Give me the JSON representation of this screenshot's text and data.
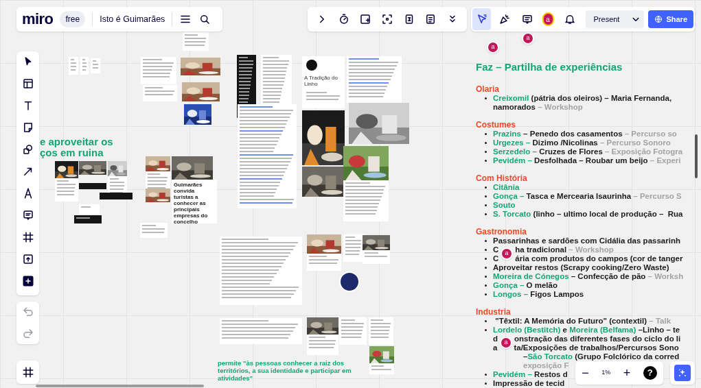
{
  "topbar": {
    "logo": "miro",
    "plan": "free",
    "board_title": "Isto é Guimarães"
  },
  "right_tools": [
    {
      "kind": "cursors",
      "selected": true
    },
    {
      "kind": "reactions",
      "selected": false
    },
    {
      "kind": "comments",
      "selected": false
    }
  ],
  "user": {
    "avatar": "a",
    "present": "Present",
    "share": "Share"
  },
  "canvas": {
    "avatars": [
      {
        "label": "a"
      },
      {
        "label": "a"
      },
      {
        "label": "a"
      },
      {
        "label": "a"
      }
    ],
    "left_heading_lines": [
      "e aproveitar os",
      "ços em ruina"
    ],
    "quote_lines": [
      "permite \"às pessoas conhecer a raiz dos",
      "territórios, a sua identidade e participar em",
      "atividades\""
    ],
    "cards": [
      {
        "title": "A Tradição do Linho"
      },
      {
        "title": "Guimarães convida turistas a conhecer as principais empresas do concelho"
      }
    ]
  },
  "panel": {
    "title": "Faz – Partilha de experiências",
    "sections": [
      {
        "title": "Olaria",
        "items": [
          {
            "lines": [
              {
                "segments": [
                  {
                    "kind": "place",
                    "text": "Creixomil"
                  },
                  {
                    "kind": "desc",
                    "text": " (pátria dos oleiros) – Maria Fernanda,"
                  }
                ]
              },
              {
                "segments": [
                  {
                    "kind": "desc",
                    "text": "namorados"
                  },
                  {
                    "kind": "activity",
                    "text": " – Workshop"
                  }
                ]
              }
            ]
          }
        ]
      },
      {
        "title": "Costumes",
        "items": [
          {
            "lines": [
              {
                "segments": [
                  {
                    "kind": "place",
                    "text": "Prazins"
                  },
                  {
                    "kind": "desc",
                    "text": " – Penedo dos casamentos"
                  },
                  {
                    "kind": "activity",
                    "text": " – Percurso so"
                  }
                ]
              }
            ]
          },
          {
            "lines": [
              {
                "segments": [
                  {
                    "kind": "place",
                    "text": "Urgezes – "
                  },
                  {
                    "kind": "desc",
                    "text": "Dizimo /Nicolinas"
                  },
                  {
                    "kind": "activity",
                    "text": " – Percurso Sonoro"
                  }
                ]
              }
            ]
          },
          {
            "lines": [
              {
                "segments": [
                  {
                    "kind": "place",
                    "text": "Serzedelo – "
                  },
                  {
                    "kind": "desc",
                    "text": "Cruzes de Flores"
                  },
                  {
                    "kind": "activity",
                    "text": " – Exposição Fotogra"
                  }
                ]
              }
            ]
          },
          {
            "lines": [
              {
                "segments": [
                  {
                    "kind": "place",
                    "text": "Pevidém – "
                  },
                  {
                    "kind": "desc",
                    "text": "Desfolhada – Roubar um beijo"
                  },
                  {
                    "kind": "activity",
                    "text": " – Experi"
                  }
                ]
              }
            ]
          }
        ]
      },
      {
        "title": "Com História",
        "items": [
          {
            "lines": [
              {
                "segments": [
                  {
                    "kind": "place",
                    "text": "Citânia"
                  }
                ]
              }
            ]
          },
          {
            "lines": [
              {
                "segments": [
                  {
                    "kind": "place",
                    "text": "Gonça – "
                  },
                  {
                    "kind": "desc",
                    "text": "Tasca e Mercearia Isaurinha"
                  },
                  {
                    "kind": "activity",
                    "text": " – Percurso S"
                  }
                ]
              }
            ]
          },
          {
            "lines": [
              {
                "segments": [
                  {
                    "kind": "place",
                    "text": "Souto"
                  }
                ]
              }
            ]
          },
          {
            "lines": [
              {
                "segments": [
                  {
                    "kind": "place",
                    "text": "S. Torcato"
                  },
                  {
                    "kind": "desc",
                    "text": " (linho – ultimo local de produção –  Rua"
                  }
                ]
              }
            ]
          }
        ]
      },
      {
        "title": "Gastronomia",
        "items": [
          {
            "lines": [
              {
                "segments": [
                  {
                    "kind": "desc",
                    "text": "Passarinhas e sardões com Cidália das passarinh"
                  }
                ]
              }
            ]
          },
          {
            "lines": [
              {
                "segments": [
                  {
                    "kind": "desc",
                    "text": "C"
                  },
                  {
                    "kind": "gap"
                  },
                  {
                    "kind": "desc",
                    "text": "ha tradicional"
                  },
                  {
                    "kind": "activity",
                    "text": " – Workshop"
                  }
                ]
              }
            ]
          },
          {
            "lines": [
              {
                "segments": [
                  {
                    "kind": "desc",
                    "text": "C"
                  },
                  {
                    "kind": "gap"
                  },
                  {
                    "kind": "desc",
                    "text": "ária com produtos do campos (cor de tanger"
                  }
                ]
              }
            ]
          },
          {
            "lines": [
              {
                "segments": [
                  {
                    "kind": "desc",
                    "text": "Aproveitar restos (Scrapy cooking/Zero Waste)"
                  }
                ]
              }
            ]
          },
          {
            "lines": [
              {
                "segments": [
                  {
                    "kind": "place",
                    "text": "Moreira de Cónegos"
                  },
                  {
                    "kind": "desc",
                    "text": " – Confecção de pão"
                  },
                  {
                    "kind": "activity",
                    "text": " – Worksh"
                  }
                ]
              }
            ]
          },
          {
            "lines": [
              {
                "segments": [
                  {
                    "kind": "place",
                    "text": "Gonça – "
                  },
                  {
                    "kind": "desc",
                    "text": "O melão"
                  }
                ]
              }
            ]
          },
          {
            "lines": [
              {
                "segments": [
                  {
                    "kind": "place",
                    "text": "Longos – "
                  },
                  {
                    "kind": "desc",
                    "text": "Figos Lampos"
                  }
                ]
              }
            ]
          }
        ]
      },
      {
        "title": "Industria",
        "items": [
          {
            "lines": [
              {
                "segments": [
                  {
                    "kind": "desc",
                    "text": " \"Têxtil: A Memória do Futuro\" (contextil)"
                  },
                  {
                    "kind": "activity",
                    "text": " – Talk"
                  }
                ]
              }
            ]
          },
          {
            "lines": [
              {
                "segments": [
                  {
                    "kind": "place",
                    "text": "Lordelo (Bestitch)"
                  },
                  {
                    "kind": "desc",
                    "text": " e "
                  },
                  {
                    "kind": "place",
                    "text": "Moreira (Belfama)"
                  },
                  {
                    "kind": "desc",
                    "text": " –Linho – te"
                  }
                ]
              },
              {
                "segments": [
                  {
                    "kind": "desc",
                    "text": "d"
                  },
                  {
                    "kind": "gap"
                  },
                  {
                    "kind": "desc",
                    "text": "onstração das diferentes fases do ciclo do li"
                  }
                ]
              },
              {
                "segments": [
                  {
                    "kind": "desc",
                    "text": "a"
                  },
                  {
                    "kind": "gap"
                  },
                  {
                    "kind": "desc",
                    "text": "ta/Exposições de trabalhos/Percursos Sono"
                  }
                ]
              },
              {
                "indent": true,
                "segments": [
                  {
                    "kind": "desc",
                    "text": "–"
                  },
                  {
                    "kind": "place",
                    "text": "São Torcato"
                  },
                  {
                    "kind": "desc",
                    "text": " (Grupo Folclórico da corred"
                  }
                ]
              },
              {
                "indent": true,
                "segments": [
                  {
                    "kind": "activity",
                    "text": "exposição F"
                  }
                ]
              }
            ]
          },
          {
            "lines": [
              {
                "segments": [
                  {
                    "kind": "place",
                    "text": "Pevidém – "
                  },
                  {
                    "kind": "desc",
                    "text": "Restos d"
                  }
                ]
              }
            ]
          },
          {
            "lines": [
              {
                "segments": [
                  {
                    "kind": "desc",
                    "text": "Impressão de tecid"
                  }
                ]
              }
            ]
          }
        ]
      }
    ]
  },
  "zoom": {
    "minus": "−",
    "level": "1%",
    "plus": "+",
    "help": "?"
  }
}
